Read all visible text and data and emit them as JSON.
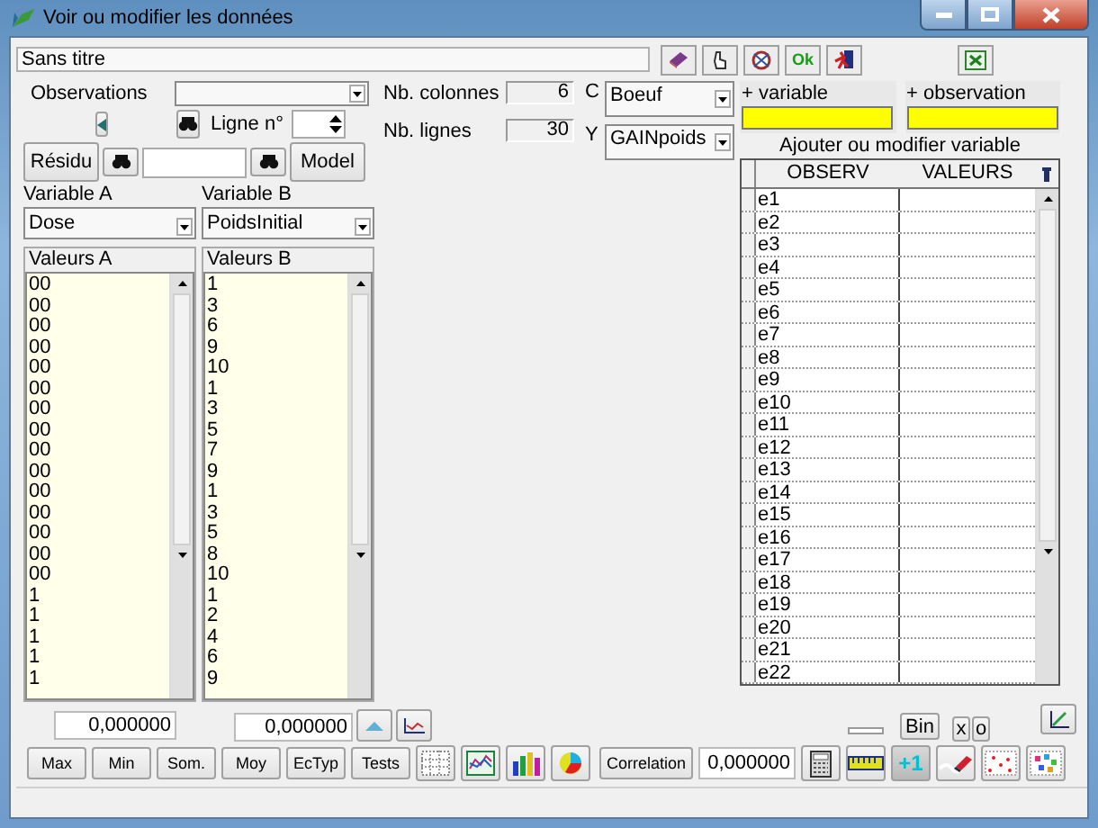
{
  "window": {
    "title": "Voir ou modifier les données"
  },
  "document": {
    "name": "Sans titre"
  },
  "ok_label": "Ok",
  "observations": {
    "label": "Observations"
  },
  "ligne": {
    "label": "Ligne n°"
  },
  "residu_button": "Résidu",
  "model_button": "Model",
  "counts": [
    {
      "label": "Nb. colonnes",
      "value": "6"
    },
    {
      "label": "Nb. lignes",
      "value": "30"
    }
  ],
  "axes": [
    {
      "label": "C",
      "value": "Boeuf"
    },
    {
      "label": "Y",
      "value": "GAINpoids"
    }
  ],
  "add_fields": [
    {
      "label": "+ variable"
    },
    {
      "label": "+ observation"
    }
  ],
  "grid": {
    "caption": "Ajouter ou modifier variable",
    "columns": [
      "OBSERV",
      "VALEURS"
    ],
    "rows": [
      "e1",
      "e2",
      "e3",
      "e4",
      "e5",
      "e6",
      "e7",
      "e8",
      "e9",
      "e10",
      "e11",
      "e12",
      "e13",
      "e14",
      "e15",
      "e16",
      "e17",
      "e18",
      "e19",
      "e20",
      "e21",
      "e22"
    ]
  },
  "variables": [
    {
      "label": "Variable A",
      "value": "Dose",
      "values_label": "Valeurs A",
      "values": [
        "00",
        "00",
        "00",
        "00",
        "00",
        "00",
        "00",
        "00",
        "00",
        "00",
        "00",
        "00",
        "00",
        "00",
        "00",
        "1",
        "1",
        "1",
        "1",
        "1"
      ]
    },
    {
      "label": "Variable B",
      "value": "PoidsInitial",
      "values_label": "Valeurs B",
      "values": [
        "1",
        "3",
        "6",
        "9",
        "10",
        "1",
        "3",
        "5",
        "7",
        "9",
        "1",
        "3",
        "5",
        "8",
        "10",
        "1",
        "2",
        "4",
        "6",
        "9"
      ]
    }
  ],
  "results": [
    "0,000000",
    "0,000000"
  ],
  "stat_buttons": [
    "Max",
    "Min",
    "Som.",
    "Moy",
    "EcTyp",
    "Tests"
  ],
  "correlation": {
    "label": "Correlation",
    "value": "0,000000"
  },
  "increment_label": "+1",
  "bin_button": "Bin",
  "toggle_buttons": [
    "x",
    "o"
  ]
}
